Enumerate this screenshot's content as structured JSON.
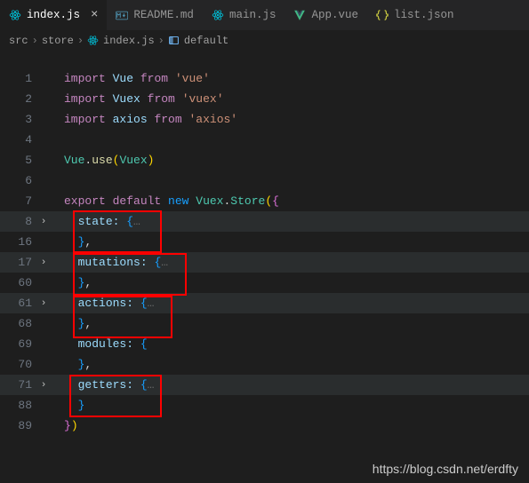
{
  "tabs": [
    {
      "label": "index.js",
      "icon": "react",
      "active": true,
      "closeable": true
    },
    {
      "label": "README.md",
      "icon": "markdown",
      "active": false
    },
    {
      "label": "main.js",
      "icon": "react",
      "active": false
    },
    {
      "label": "App.vue",
      "icon": "vue",
      "active": false
    },
    {
      "label": "list.json",
      "icon": "json",
      "active": false
    }
  ],
  "breadcrumb": {
    "items": [
      {
        "label": "src"
      },
      {
        "label": "store"
      },
      {
        "label": "index.js",
        "icon": "react"
      },
      {
        "label": "default",
        "icon": "symbol"
      }
    ]
  },
  "code": {
    "l1_import": "import",
    "l1_vue": "Vue",
    "l1_from": "from",
    "l1_str": "'vue'",
    "l2_import": "import",
    "l2_vuex": "Vuex",
    "l2_from": "from",
    "l2_str": "'vuex'",
    "l3_import": "import",
    "l3_axios": "axios",
    "l3_from": "from",
    "l3_str": "'axios'",
    "l5_vue": "Vue",
    "l5_use": "use",
    "l5_arg": "Vuex",
    "l7_export": "export",
    "l7_default": "default",
    "l7_new": "new",
    "l7_vuex": "Vuex",
    "l7_store": "Store",
    "l8_state": "state:",
    "l8_fold": "…",
    "l16_close": "},",
    "l17_mut": "mutations:",
    "l17_fold": "…",
    "l60_close": "},",
    "l61_act": "actions:",
    "l61_fold": "…",
    "l68_close": "},",
    "l69_mod": "modules:",
    "l70_close": "},",
    "l71_get": "getters:",
    "l71_fold": "…",
    "l88_close": "}",
    "l89_close": "})"
  },
  "lines": {
    "n1": "1",
    "n2": "2",
    "n3": "3",
    "n4": "4",
    "n5": "5",
    "n6": "6",
    "n7": "7",
    "n8": "8",
    "n16": "16",
    "n17": "17",
    "n60": "60",
    "n61": "61",
    "n68": "68",
    "n69": "69",
    "n70": "70",
    "n71": "71",
    "n88": "88",
    "n89": "89"
  },
  "folds": {
    "chev": "›"
  },
  "watermark": "https://blog.csdn.net/erdfty"
}
